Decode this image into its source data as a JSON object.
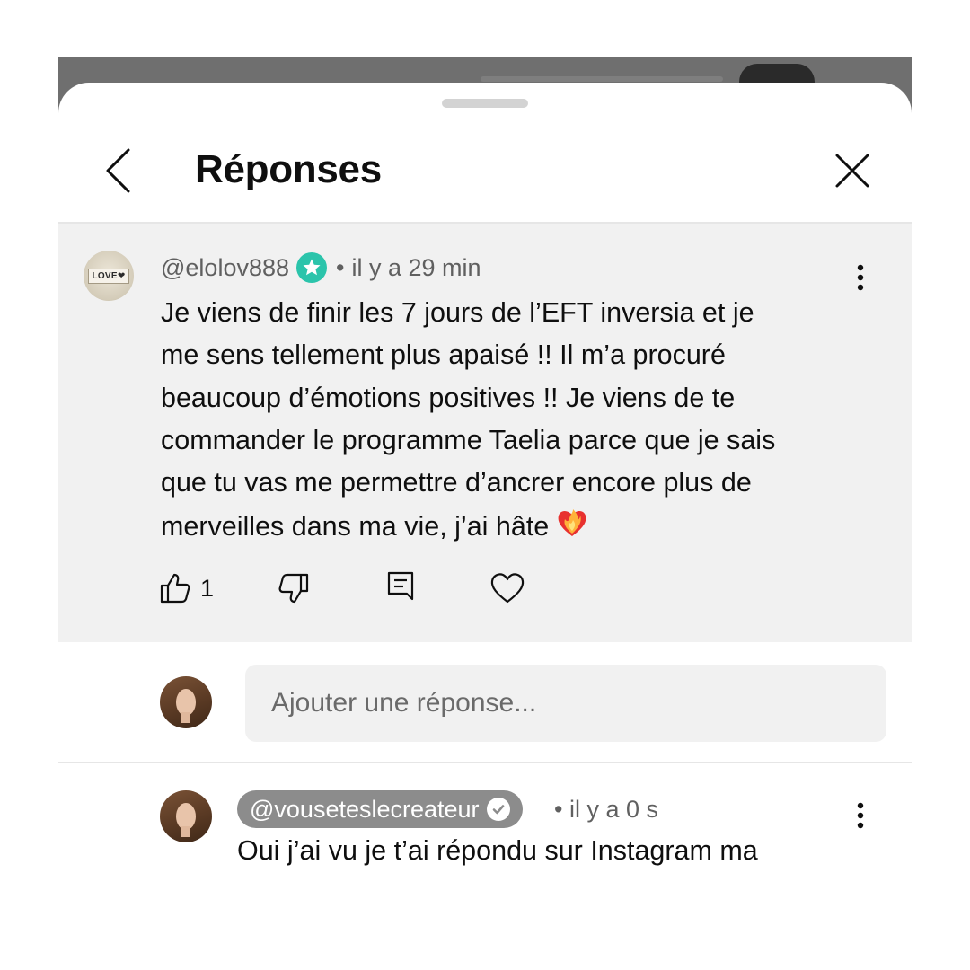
{
  "header": {
    "title": "Réponses"
  },
  "comment": {
    "author": "@elolov888",
    "avatar_text": "LOVE❤",
    "separator": "•",
    "time": "il y a 29 min",
    "lines": [
      "Je viens de finir les 7 jours de l’EFT inversia et je",
      "me sens tellement plus apaisé !! Il m’a procuré",
      "beaucoup d’émotions positives !! Je viens de te",
      "commander le programme Taelia parce que je sais",
      "que tu vas me permettre d’ancrer encore plus de",
      "merveilles dans ma vie, j’ai hâte"
    ],
    "like_count": "1",
    "icons": {
      "badge": "star-badge-icon",
      "like": "thumbs-up-icon",
      "dislike": "thumbs-down-icon",
      "reply": "reply-comment-icon",
      "heart": "heart-icon",
      "more": "more-vertical-icon",
      "emoji": "heart-on-fire-emoji"
    }
  },
  "reply_box": {
    "placeholder": "Ajouter une réponse..."
  },
  "reply": {
    "author": "@vouseteslecreateur",
    "separator": "•",
    "time": "il y a 0 s",
    "text": "Oui j’ai vu je t’ai répondu sur Instagram ma",
    "icons": {
      "badge": "verified-check-icon",
      "more": "more-vertical-icon"
    }
  },
  "colors": {
    "comment_background": "#f1f1f1",
    "star_badge": "#2bc4ab",
    "creator_chip": "#8c8c8c",
    "meta_text": "#606060"
  }
}
